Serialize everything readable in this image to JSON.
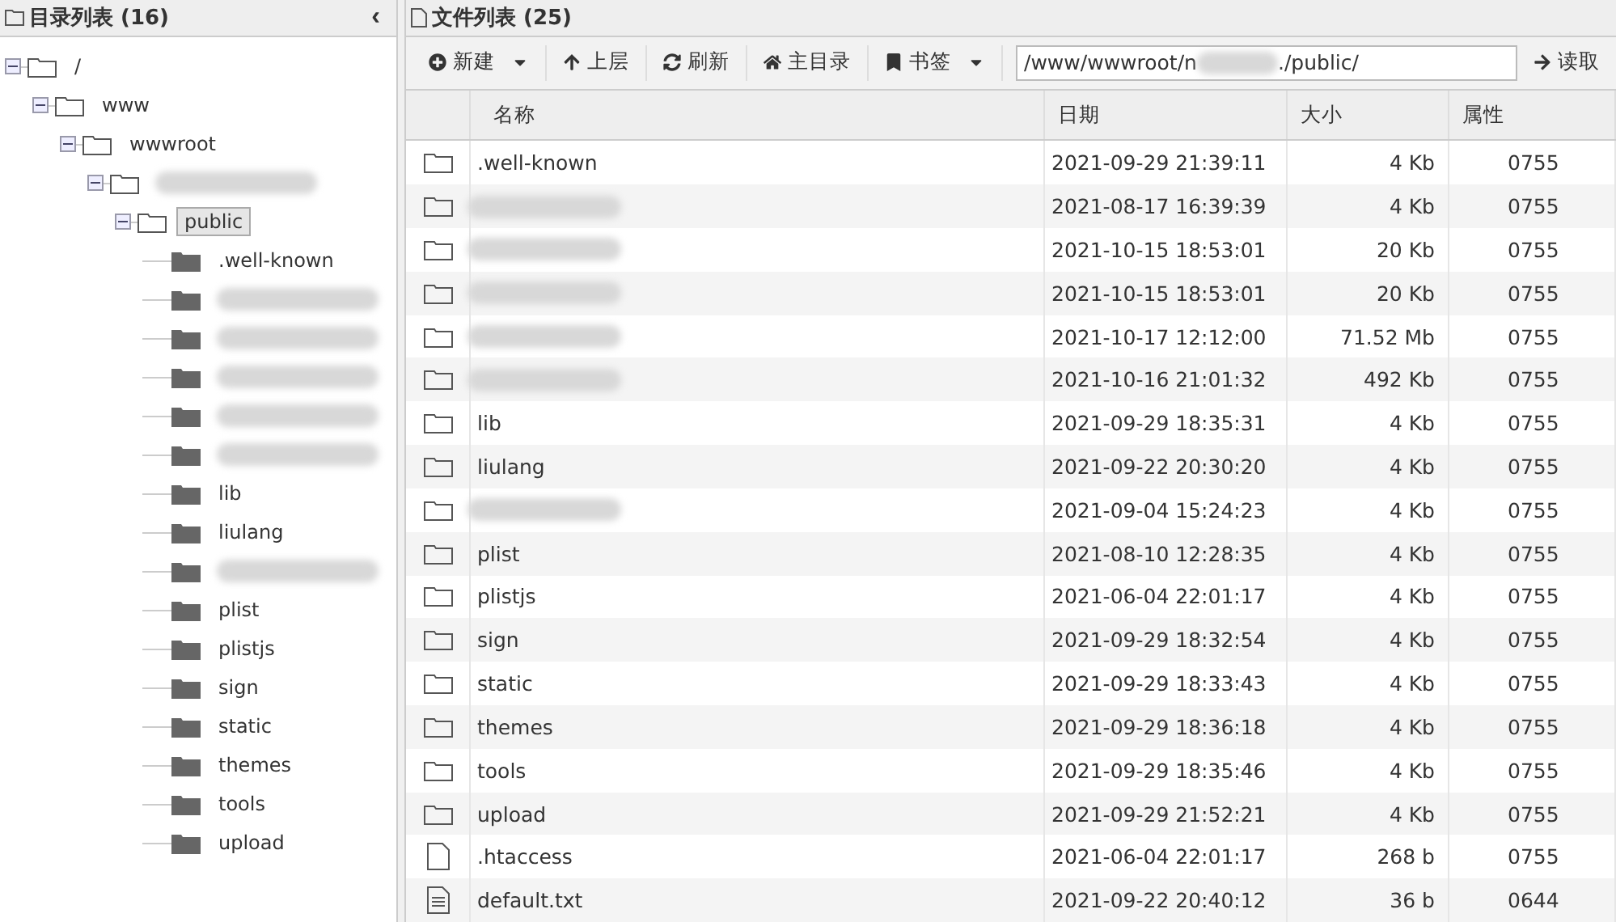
{
  "dir_panel": {
    "title": "目录列表 (16)",
    "collapse": "‹",
    "tree": [
      {
        "name": "/",
        "expanded": true,
        "selected": false,
        "children": [
          {
            "name": "www",
            "expanded": true,
            "selected": false,
            "children": [
              {
                "name": "wwwroot",
                "expanded": true,
                "selected": false,
                "children": [
                  {
                    "redacted": true,
                    "expanded": true,
                    "children": [
                      {
                        "name": "public",
                        "expanded": true,
                        "selected": true,
                        "children": [
                          {
                            "name": ".well-known",
                            "selected": false
                          },
                          {
                            "redacted": true
                          },
                          {
                            "redacted": true
                          },
                          {
                            "redacted": true
                          },
                          {
                            "redacted": true
                          },
                          {
                            "redacted": true
                          },
                          {
                            "name": "lib",
                            "selected": false
                          },
                          {
                            "name": "liulang",
                            "selected": false
                          },
                          {
                            "redacted": true
                          },
                          {
                            "name": "plist",
                            "selected": false
                          },
                          {
                            "name": "plistjs",
                            "selected": false
                          },
                          {
                            "name": "sign",
                            "selected": false
                          },
                          {
                            "name": "static",
                            "selected": false
                          },
                          {
                            "name": "themes",
                            "selected": false
                          },
                          {
                            "name": "tools",
                            "selected": false
                          },
                          {
                            "name": "upload",
                            "selected": false
                          }
                        ]
                      }
                    ]
                  }
                ]
              }
            ]
          }
        ]
      }
    ]
  },
  "file_panel": {
    "title": "文件列表 (25)",
    "toolbar": [
      {
        "kind": "new",
        "label": "新建",
        "dropdown": true
      },
      {
        "kind": "up",
        "label": "上层",
        "dropdown": false
      },
      {
        "kind": "refresh",
        "label": "刷新",
        "dropdown": false
      },
      {
        "kind": "home",
        "label": "主目录",
        "dropdown": false
      },
      {
        "kind": "bookmark",
        "label": "书签",
        "dropdown": true
      }
    ],
    "path": {
      "start": "/www/wwwroot/n",
      "redacted": true,
      "end": "./public/"
    },
    "read_button": "读取",
    "columns": [
      "名称",
      "日期",
      "大小",
      "属性"
    ],
    "rows": [
      {
        "kind": "folder",
        "name": ".well-known",
        "date": "2021-09-29 21:39:11",
        "size": "4 Kb",
        "mode": "0755"
      },
      {
        "kind": "folder",
        "redacted": true,
        "date": "2021-08-17 16:39:39",
        "size": "4 Kb",
        "mode": "0755"
      },
      {
        "kind": "folder",
        "redacted": true,
        "date": "2021-10-15 18:53:01",
        "size": "20 Kb",
        "mode": "0755"
      },
      {
        "kind": "folder",
        "redacted": true,
        "date": "2021-10-15 18:53:01",
        "size": "20 Kb",
        "mode": "0755"
      },
      {
        "kind": "folder",
        "redacted": true,
        "date": "2021-10-17 12:12:00",
        "size": "71.52 Mb",
        "mode": "0755"
      },
      {
        "kind": "folder",
        "redacted": true,
        "date": "2021-10-16 21:01:32",
        "size": "492 Kb",
        "mode": "0755"
      },
      {
        "kind": "folder",
        "name": "lib",
        "date": "2021-09-29 18:35:31",
        "size": "4 Kb",
        "mode": "0755"
      },
      {
        "kind": "folder",
        "name": "liulang",
        "date": "2021-09-22 20:30:20",
        "size": "4 Kb",
        "mode": "0755"
      },
      {
        "kind": "folder",
        "redacted": true,
        "date": "2021-09-04 15:24:23",
        "size": "4 Kb",
        "mode": "0755"
      },
      {
        "kind": "folder",
        "name": "plist",
        "date": "2021-08-10 12:28:35",
        "size": "4 Kb",
        "mode": "0755"
      },
      {
        "kind": "folder",
        "name": "plistjs",
        "date": "2021-06-04 22:01:17",
        "size": "4 Kb",
        "mode": "0755"
      },
      {
        "kind": "folder",
        "name": "sign",
        "date": "2021-09-29 18:32:54",
        "size": "4 Kb",
        "mode": "0755"
      },
      {
        "kind": "folder",
        "name": "static",
        "date": "2021-09-29 18:33:43",
        "size": "4 Kb",
        "mode": "0755"
      },
      {
        "kind": "folder",
        "name": "themes",
        "date": "2021-09-29 18:36:18",
        "size": "4 Kb",
        "mode": "0755"
      },
      {
        "kind": "folder",
        "name": "tools",
        "date": "2021-09-29 18:35:46",
        "size": "4 Kb",
        "mode": "0755"
      },
      {
        "kind": "folder",
        "name": "upload",
        "date": "2021-09-29 21:52:21",
        "size": "4 Kb",
        "mode": "0755"
      },
      {
        "kind": "file",
        "name": ".htaccess",
        "date": "2021-06-04 22:01:17",
        "size": "268 b",
        "mode": "0755"
      },
      {
        "kind": "text",
        "name": "default.txt",
        "date": "2021-09-22 20:40:12",
        "size": "36 b",
        "mode": "0644"
      }
    ]
  }
}
